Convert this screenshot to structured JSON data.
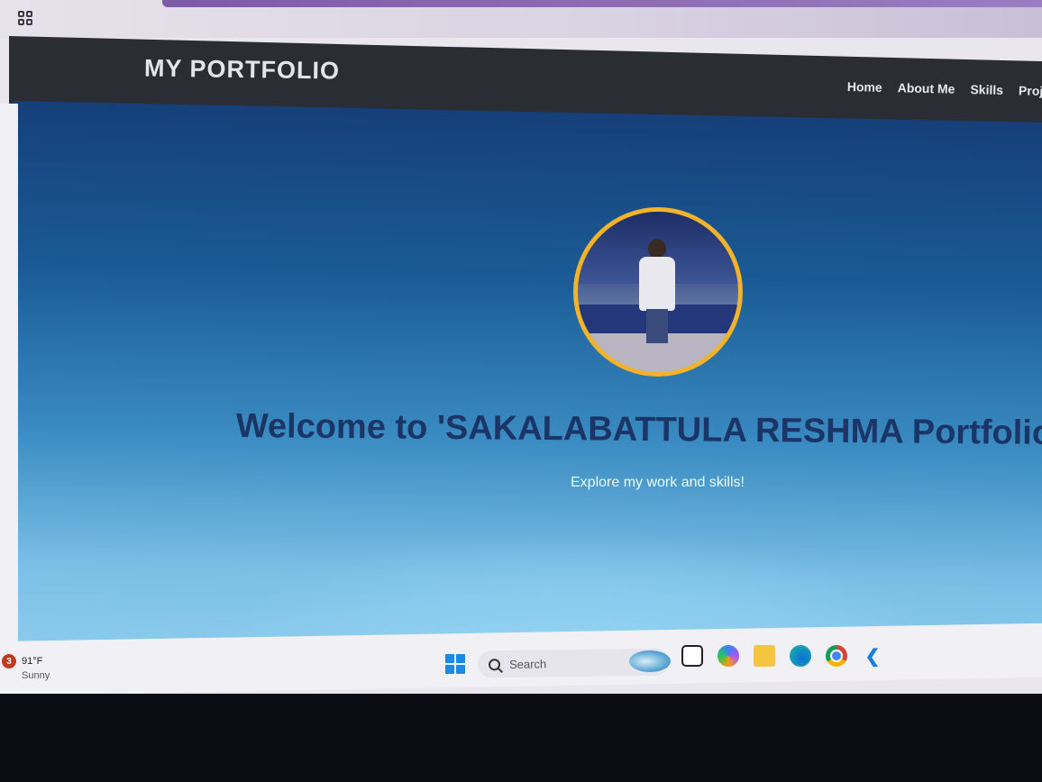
{
  "navbar": {
    "brand": "MY PORTFOLIO",
    "links": [
      "Home",
      "About Me",
      "Skills",
      "Proje"
    ]
  },
  "hero": {
    "welcome": "Welcome to 'SAKALABATTULA RESHMA Portfolio",
    "tagline": "Explore my work and skills!"
  },
  "taskbar": {
    "weather_badge": "3",
    "temperature": "91°F",
    "condition": "Sunny",
    "search_label": "Search",
    "apps": [
      "files-icon",
      "copilot-icon",
      "folder-icon",
      "edge-icon",
      "chrome-icon",
      "vscode-icon"
    ]
  },
  "colors": {
    "navbar_bg": "#2a2d34",
    "hero_top": "#163f79",
    "hero_bottom": "#8ccbed",
    "avatar_border": "#f2b22a",
    "welcome_text": "#1b3566",
    "tagline_text": "#e8fbff"
  }
}
